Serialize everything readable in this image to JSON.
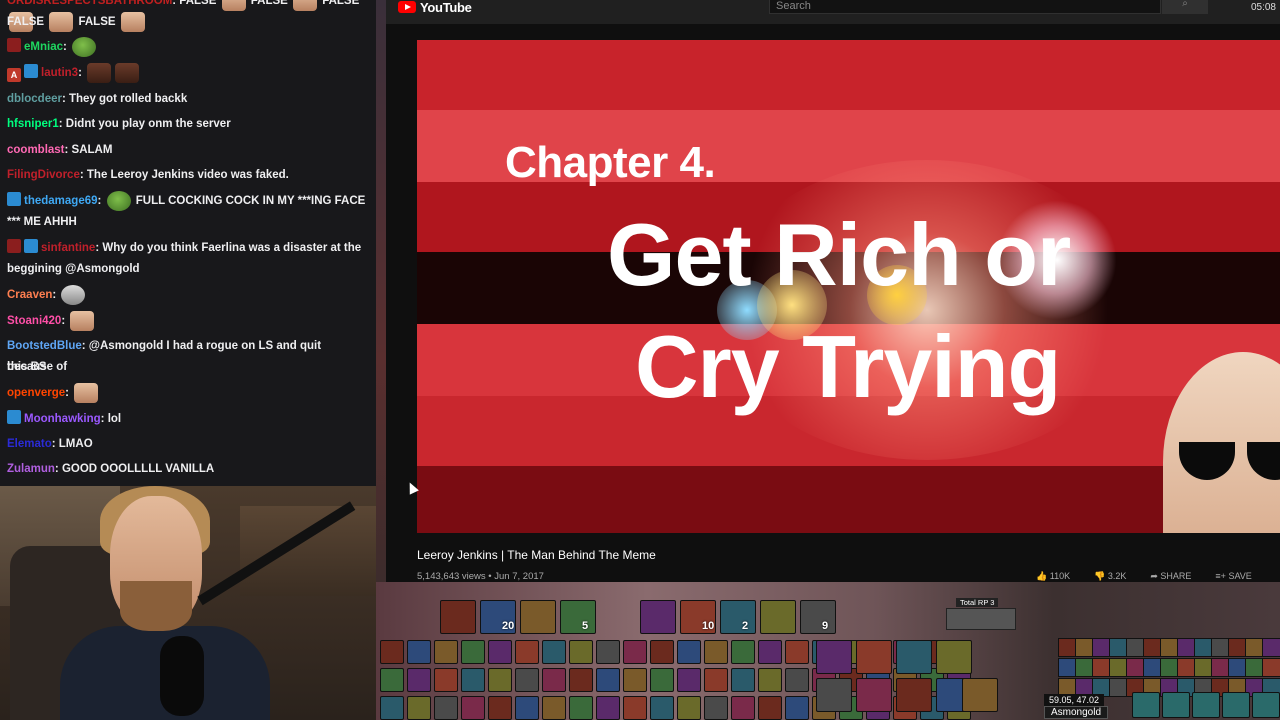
{
  "chat": {
    "messages": [
      {
        "user": "",
        "user_color": "#c02020",
        "text": "FALSE",
        "extra": "FALSE FALSE FALSE",
        "prefix": "ORDISRESPECTSBATHROOM: FALSE"
      },
      {
        "user": "eMniac",
        "user_color": "#1ed760",
        "text": ""
      },
      {
        "user": "lautin3",
        "user_color": "#c0202b",
        "text": ""
      },
      {
        "user": "dblocdeer",
        "user_color": "#5f9ea0",
        "text": "They got rolled backk"
      },
      {
        "user": "hfsniper1",
        "user_color": "#00ff7f",
        "text": "Didnt you play onm the server"
      },
      {
        "user": "coomblast",
        "user_color": "#ff69b4",
        "text": "SALAM"
      },
      {
        "user": "FilingDivorce",
        "user_color": "#c0202b",
        "text": "The Leeroy Jenkins video was faked."
      },
      {
        "user": "thedamage69",
        "user_color": "#3fa9f5",
        "text": "FULL COCKING COCK IN MY ***ING FACE",
        "text2": "*** ME AHHH"
      },
      {
        "user": "sinfantine",
        "user_color": "#c0202b",
        "text": "Why do you think Faerlina was a disaster at the",
        "text2": "beggining @Asmongold"
      },
      {
        "user": "Craaven",
        "user_color": "#ff7f50",
        "text": ""
      },
      {
        "user": "Stoani420",
        "user_color": "#ff4fa8",
        "text": ""
      },
      {
        "user": "BootstedBlue",
        "user_color": "#5fa6f5",
        "text": "@Asmongold I had a rogue on LS and quit because of",
        "text2": "this BS"
      },
      {
        "user": "openverge",
        "user_color": "#ff4500",
        "text": ""
      },
      {
        "user": "Moonhawking",
        "user_color": "#9b59ff",
        "text": "lol"
      },
      {
        "user": "Elemato",
        "user_color": "#2b2bd6",
        "text": "LMAO"
      },
      {
        "user": "Zulamun",
        "user_color": "#b05fe0",
        "text": "GOOD OOOLLLLL VANILLA"
      }
    ],
    "line0_text": "FALSE",
    "line0_row2": "FALSE",
    "line0_row2b": "FALSE"
  },
  "youtube": {
    "logo": "YouTube",
    "search_placeholder": "Search",
    "search_icon": "search-icon",
    "clock": "05:08",
    "thumbnail": {
      "chapter": "Chapter 4.",
      "title_line1": "Get Rich or",
      "title_line2": "Cry Trying"
    },
    "video_title": "Leeroy Jenkins | The Man Behind The Meme",
    "video_meta": "5,143,643 views • Jun 7, 2017",
    "likes": "110K",
    "dislikes": "3.2K",
    "share": "SHARE",
    "save": "SAVE"
  },
  "wow": {
    "total_rp": "Total RP 3",
    "coords": "59.05, 47.02",
    "player_name": "Asmongold",
    "hotbar_counts": [
      "20",
      "5",
      "10",
      "2",
      "9"
    ]
  }
}
